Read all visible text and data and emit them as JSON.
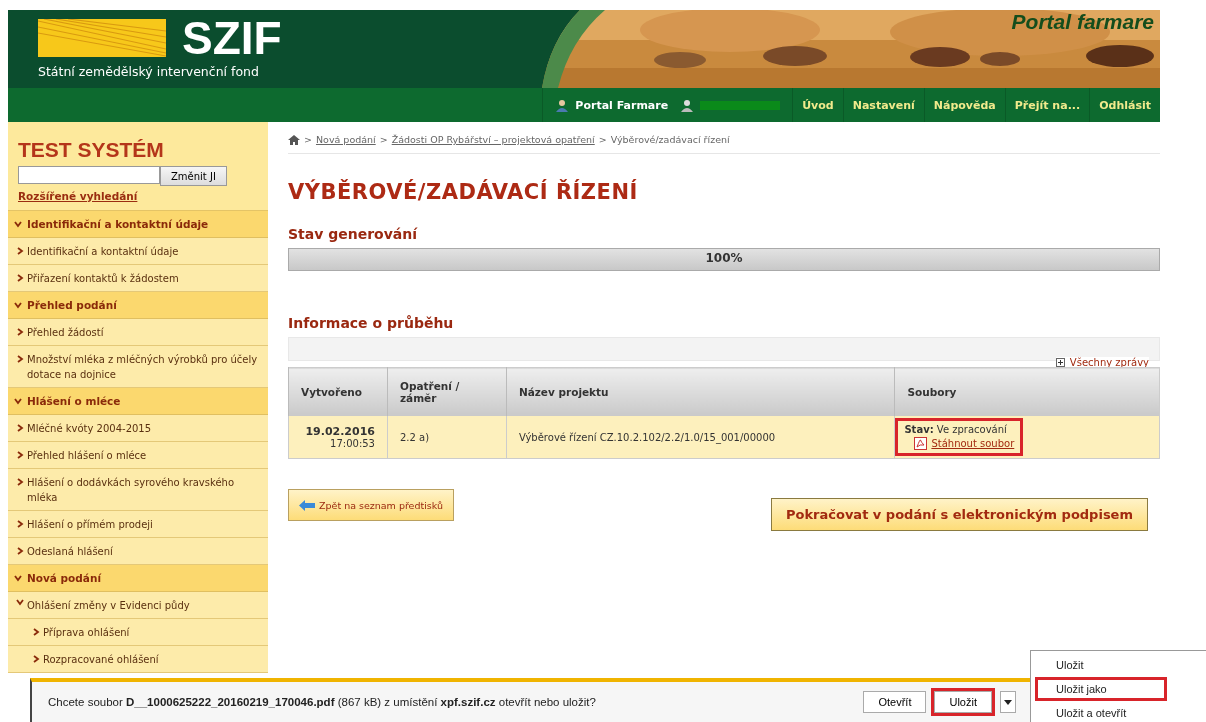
{
  "header": {
    "logo": "SZIF",
    "subtitle": "Státní zemědělský intervenční fond",
    "portal_title": "Portal farmare"
  },
  "nav": {
    "portal": "Portal Farmare",
    "items": [
      "Úvod",
      "Nastavení",
      "Nápověda",
      "Přejít na...",
      "Odhlásit"
    ]
  },
  "sidebar": {
    "title": "TEST SYSTÉM",
    "search_button": "Změnit JI",
    "advanced_link": "Rozšířené vyhledání",
    "sections": [
      {
        "label": "Identifikační a kontaktní údaje",
        "expanded": true,
        "children": [
          {
            "label": "Identifikační a kontaktní údaje"
          },
          {
            "label": "Přiřazení kontaktů k žádostem"
          }
        ]
      },
      {
        "label": "Přehled podání",
        "expanded": true,
        "children": [
          {
            "label": "Přehled žádostí"
          },
          {
            "label": "Množství mléka z mléčných výrobků pro účely dotace na dojnice"
          }
        ]
      },
      {
        "label": "Hlášení o mléce",
        "expanded": true,
        "children": [
          {
            "label": "Mléčné kvóty 2004-2015"
          },
          {
            "label": "Přehled hlášení o mléce"
          },
          {
            "label": "Hlášení o dodávkách syrového kravského mléka"
          },
          {
            "label": "Hlášení o přímém prodeji"
          },
          {
            "label": "Odeslaná hlášení"
          }
        ]
      },
      {
        "label": "Nová podání",
        "expanded": true,
        "children": [
          {
            "label": "Ohlášení změny v Evidenci půdy",
            "expanded": true,
            "children": [
              {
                "label": "Příprava ohlášení"
              },
              {
                "label": "Rozpracované ohlášení"
              }
            ]
          }
        ]
      }
    ]
  },
  "breadcrumb": {
    "separator": ">",
    "items": [
      {
        "label": "Nová podání",
        "link": true
      },
      {
        "label": "Žádosti OP Rybářství – projektová opatření",
        "link": true
      },
      {
        "label": "Výběrové/zadávací řízení",
        "link": false
      }
    ]
  },
  "title": "VÝBĚROVÉ/ZADÁVACÍ ŘÍZENÍ",
  "progress": {
    "heading": "Stav generování",
    "level": 1,
    "reading": "100%"
  },
  "info": {
    "heading": "Informace o průběhu",
    "all_messages": "Všechny zprávy"
  },
  "table": {
    "columns": [
      "Vytvořeno",
      "Opatření / záměr",
      "Název projektu",
      "Soubory"
    ],
    "rows": [
      {
        "date": "19.02.2016",
        "time": "17:00:53",
        "measure": "2.2 a)",
        "project": "Výběrové řízení CZ.10.2.102/2.2/1.0/15_001/00000",
        "status": "**Stav:** Ve zpracování",
        "download": "Stáhnout soubor",
        "highlighted": true
      }
    ]
  },
  "back_button": "Zpět na seznam předtisků",
  "continue_button": "Pokračovat v podání s elektronickým podpisem",
  "download_bar": {
    "message": "Chcete soubor **D__1000625222_20160219_170046.pdf** (867 kB) z umístění **xpf.szif.cz** otevřít nebo uložit?",
    "buttons": [
      {
        "label": "Otevřít",
        "highlighted": false
      },
      {
        "label": "Uložit",
        "highlighted": true
      }
    ]
  },
  "save_menu": [
    {
      "label": "Uložit",
      "highlighted": false
    },
    {
      "label": "Uložit jako",
      "highlighted": true
    },
    {
      "label": "Uložit a otevřít",
      "highlighted": false
    }
  ]
}
